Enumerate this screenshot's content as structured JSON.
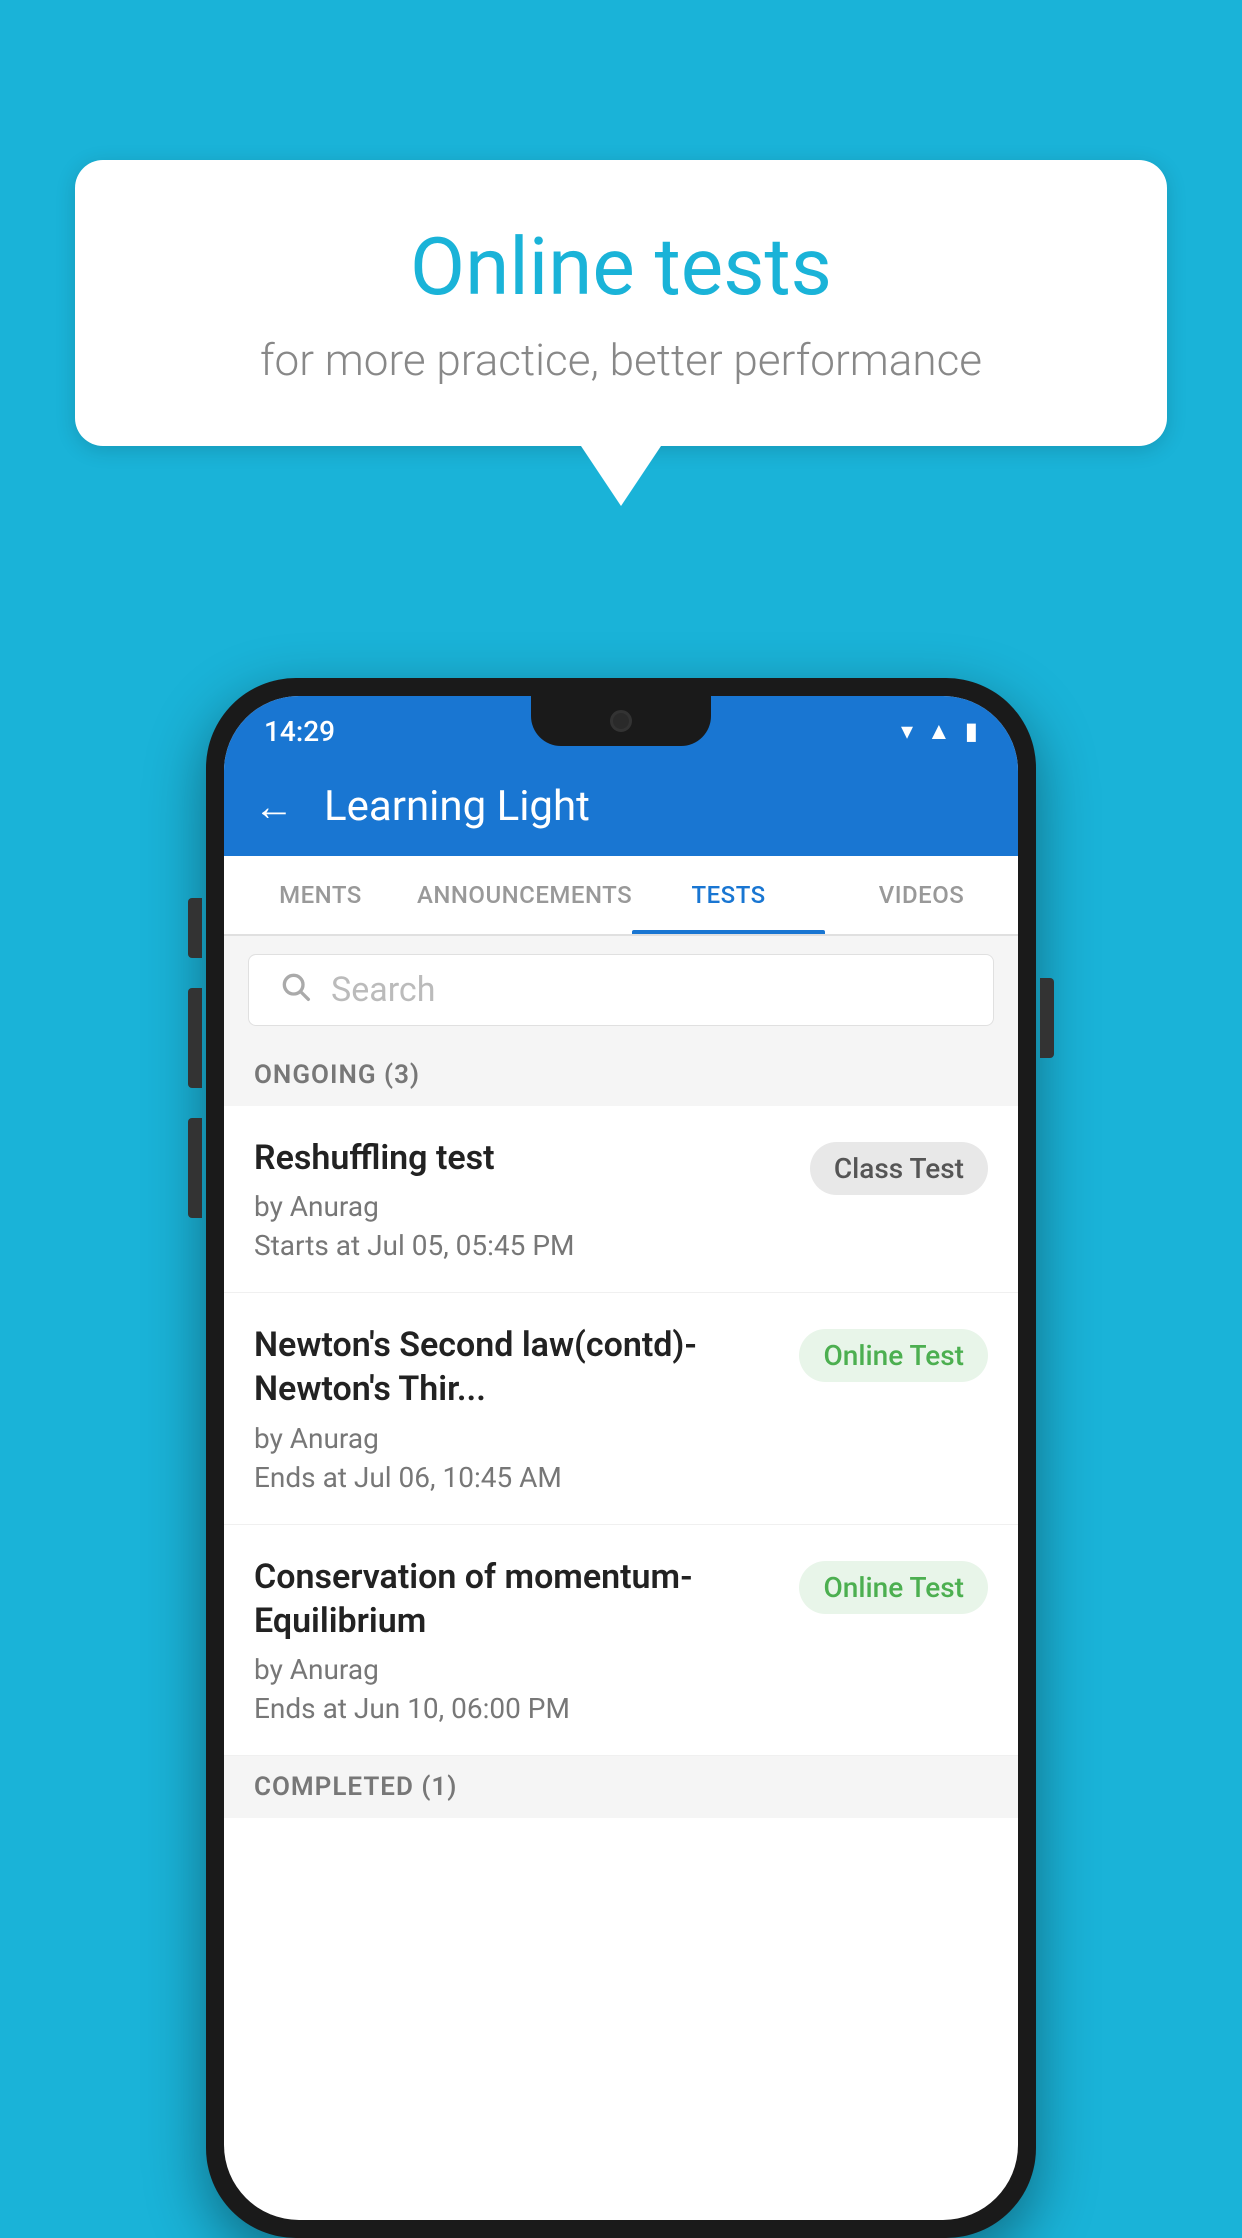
{
  "background_color": "#1ab3d8",
  "speech_bubble": {
    "title": "Online tests",
    "subtitle": "for more practice, better performance"
  },
  "phone": {
    "status_bar": {
      "time": "14:29",
      "icons": [
        "wifi",
        "signal",
        "battery"
      ]
    },
    "app_header": {
      "back_label": "←",
      "title": "Learning Light"
    },
    "tabs": [
      {
        "label": "MENTS",
        "active": false
      },
      {
        "label": "ANNOUNCEMENTS",
        "active": false
      },
      {
        "label": "TESTS",
        "active": true
      },
      {
        "label": "VIDEOS",
        "active": false
      }
    ],
    "search": {
      "placeholder": "Search"
    },
    "ongoing_section": {
      "header": "ONGOING (3)",
      "items": [
        {
          "title": "Reshuffling test",
          "author": "by Anurag",
          "date": "Starts at  Jul 05, 05:45 PM",
          "badge": "Class Test",
          "badge_type": "class"
        },
        {
          "title": "Newton's Second law(contd)-Newton's Thir...",
          "author": "by Anurag",
          "date": "Ends at  Jul 06, 10:45 AM",
          "badge": "Online Test",
          "badge_type": "online"
        },
        {
          "title": "Conservation of momentum-Equilibrium",
          "author": "by Anurag",
          "date": "Ends at  Jun 10, 06:00 PM",
          "badge": "Online Test",
          "badge_type": "online"
        }
      ]
    },
    "completed_section": {
      "header": "COMPLETED (1)"
    }
  }
}
